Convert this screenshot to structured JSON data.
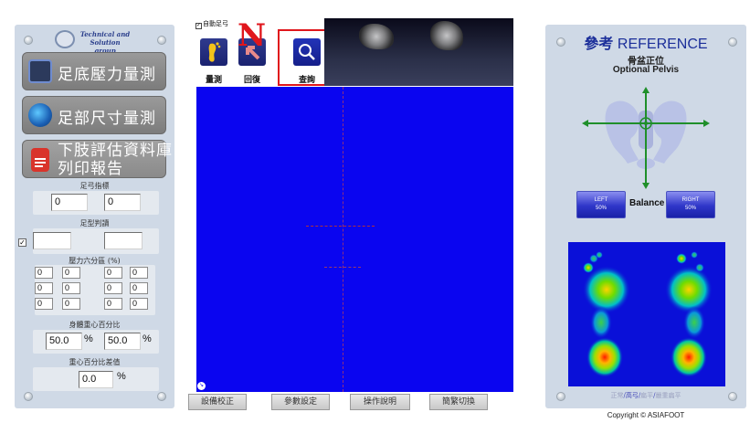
{
  "left_panel": {
    "logo_text": "Technical and Solution group",
    "buttons": [
      {
        "label": "足底壓力量測",
        "icon": "foot-pressure-icon"
      },
      {
        "label": "足部尺寸量測",
        "icon": "globe-icon"
      },
      {
        "label_line1": "下肢評估資料庫",
        "label_line2": "列印報告",
        "icon": "document-icon"
      }
    ],
    "shoe_size": {
      "title": "足弓指標",
      "left_value": "0",
      "right_value": "0"
    },
    "foot_type": {
      "title": "足型判讀",
      "checked": true,
      "left_value": "",
      "right_value": ""
    },
    "pressure_six": {
      "title": "壓力六分區 (%)",
      "left": [
        "0",
        "0",
        "0",
        "0",
        "0",
        "0"
      ],
      "right": [
        "0",
        "0",
        "0",
        "0",
        "0",
        "0"
      ]
    },
    "body_cog": {
      "title": "身體重心百分比",
      "left_value": "50.0",
      "right_value": "50.0",
      "unit": "%"
    },
    "cog_diff": {
      "title": "重心百分比差值",
      "value": "0.0",
      "unit": "%"
    }
  },
  "toolbar": {
    "auto_checkbox_label": "自動足弓",
    "buttons": [
      {
        "label": "量測",
        "icon": "foot-icon"
      },
      {
        "label": "回復",
        "icon": "undo-icon"
      },
      {
        "label": "查詢",
        "icon": "search-icon"
      }
    ],
    "overlay_letter": "N"
  },
  "bottom_buttons": [
    "設備校正",
    "參數設定",
    "操作說明",
    "簡繁切換"
  ],
  "reference": {
    "title_cn": "參考",
    "title_en": "REFERENCE",
    "subtitle_cn": "骨盆正位",
    "subtitle_en": "Optional Pelvis",
    "left_btn": {
      "label": "LEFT",
      "value": "50%"
    },
    "balance_label": "Balance",
    "right_btn": {
      "label": "RIGHT",
      "value": "50%"
    },
    "legend": {
      "a": "正常",
      "b": "高弓",
      "c": "扁平",
      "d": "嚴重扁平",
      "sep": "/"
    }
  },
  "copyright": "Copyright © ASIAFOOT",
  "colors": {
    "canvas": "#0a05f0",
    "accent_red": "#e0161c",
    "title_blue": "#1c2f9a",
    "arrow_green": "#1f8f2a"
  }
}
